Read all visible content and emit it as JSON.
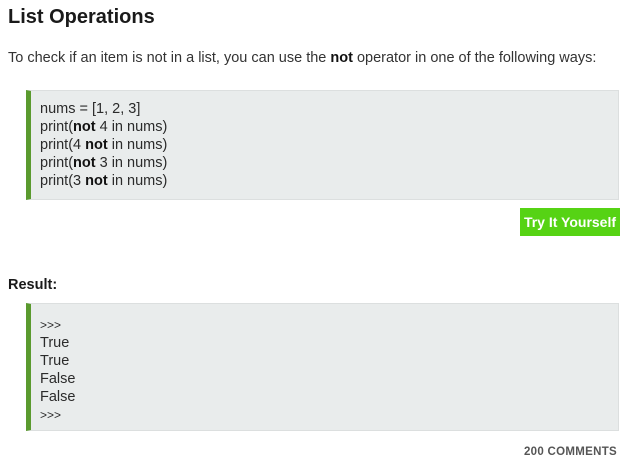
{
  "lesson": {
    "title": "List Operations",
    "intro_before": "To check if an item is not in a list, you can use the ",
    "intro_keyword": "not",
    "intro_after": " operator in one of the following ways:"
  },
  "code": {
    "line1": "nums = [1, 2, 3]",
    "line2_pre": "print(",
    "line2_kw": "not",
    "line2_post": " 4 in nums)",
    "line3_pre": "print(4 ",
    "line3_kw": "not",
    "line3_post": " in nums)",
    "line4_pre": "print(",
    "line4_kw": "not",
    "line4_post": " 3 in nums)",
    "line5_pre": "print(3 ",
    "line5_kw": "not",
    "line5_post": " in nums)"
  },
  "try_button": {
    "label": "Try It Yourself",
    "color": "#56d314"
  },
  "result": {
    "label": "Result:",
    "lines": [
      ">>>",
      "True",
      "True",
      "False",
      "False",
      ">>>"
    ]
  },
  "comments": {
    "label": "200 COMMENTS"
  },
  "colors": {
    "accent_border": "#5a9a2e",
    "code_background": "#e9ecec"
  }
}
